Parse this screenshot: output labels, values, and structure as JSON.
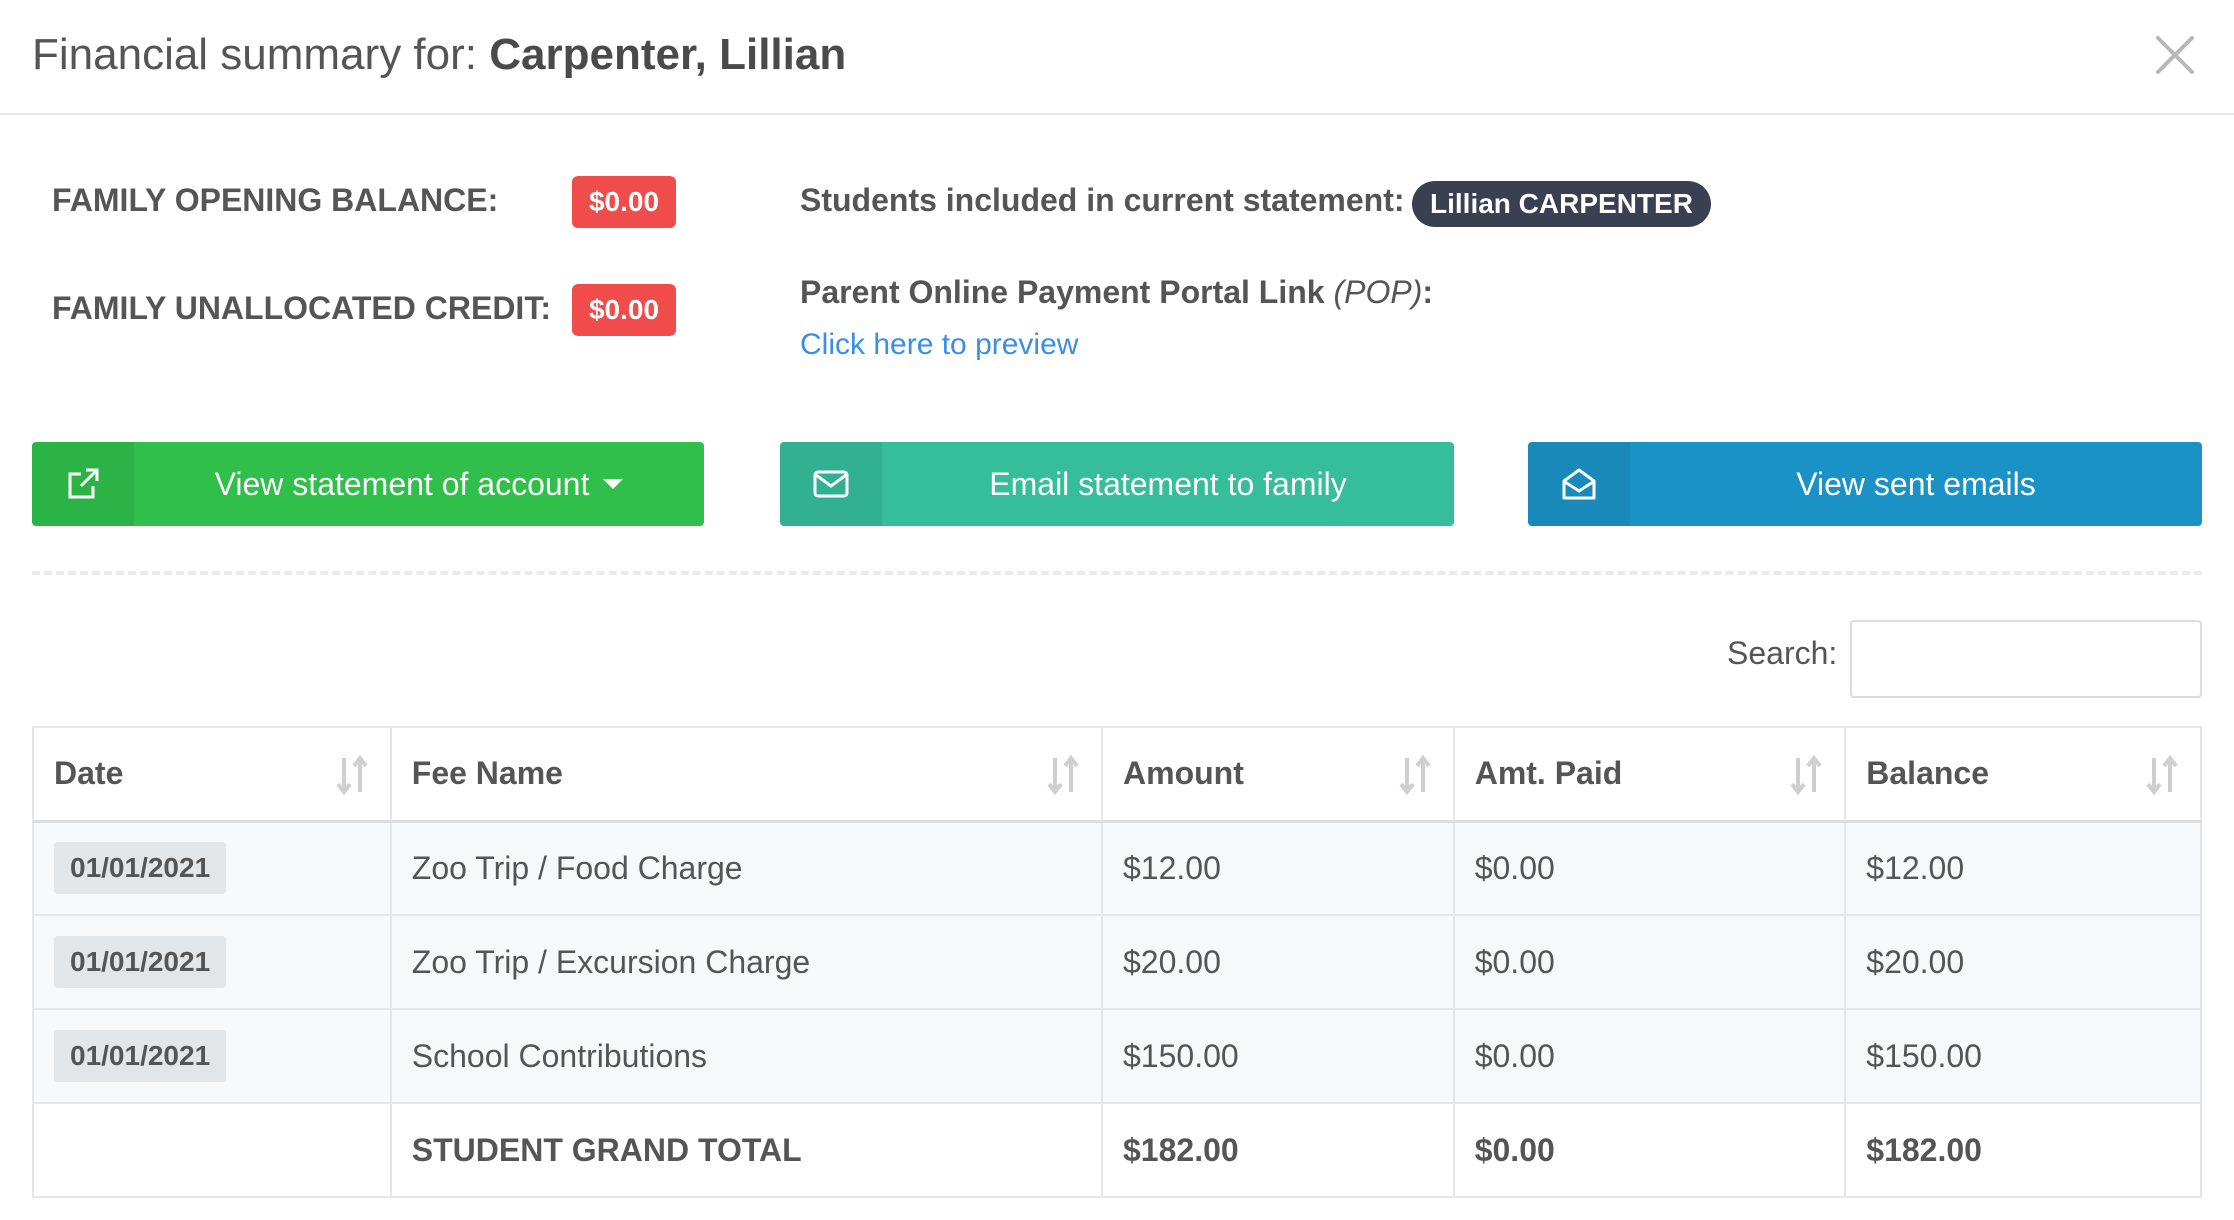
{
  "header": {
    "title_prefix": "Financial summary for: ",
    "title_name": "Carpenter, Lillian"
  },
  "summary": {
    "opening_balance_label": "FAMILY OPENING BALANCE:",
    "opening_balance_value": "$0.00",
    "unallocated_credit_label": "FAMILY UNALLOCATED CREDIT:",
    "unallocated_credit_value": "$0.00",
    "students_label": "Students included in current statement:",
    "student_name": "Lillian CARPENTER",
    "pop_label": "Parent Online Payment Portal Link ",
    "pop_abbr": "(POP)",
    "pop_colon": ":",
    "preview_link": "Click here to preview"
  },
  "actions": {
    "view_statement": "View statement of account",
    "email_statement": "Email statement to family",
    "view_sent_emails": "View sent emails"
  },
  "search": {
    "label": "Search:",
    "value": ""
  },
  "table": {
    "columns": [
      "Date",
      "Fee Name",
      "Amount",
      "Amt. Paid",
      "Balance"
    ],
    "rows": [
      {
        "date": "01/01/2021",
        "fee": "Zoo Trip / Food Charge",
        "amount": "$12.00",
        "paid": "$0.00",
        "balance": "$12.00"
      },
      {
        "date": "01/01/2021",
        "fee": "Zoo Trip / Excursion Charge",
        "amount": "$20.00",
        "paid": "$0.00",
        "balance": "$20.00"
      },
      {
        "date": "01/01/2021",
        "fee": "School Contributions",
        "amount": "$150.00",
        "paid": "$0.00",
        "balance": "$150.00"
      }
    ],
    "total": {
      "label": "STUDENT GRAND TOTAL",
      "amount": "$182.00",
      "paid": "$0.00",
      "balance": "$182.00"
    }
  },
  "colors": {
    "badge_red": "#f04c4c",
    "btn_green": "#2fbf4a",
    "btn_teal": "#36bd9a",
    "btn_blue": "#1b92c6",
    "link_blue": "#3a8ee6"
  }
}
